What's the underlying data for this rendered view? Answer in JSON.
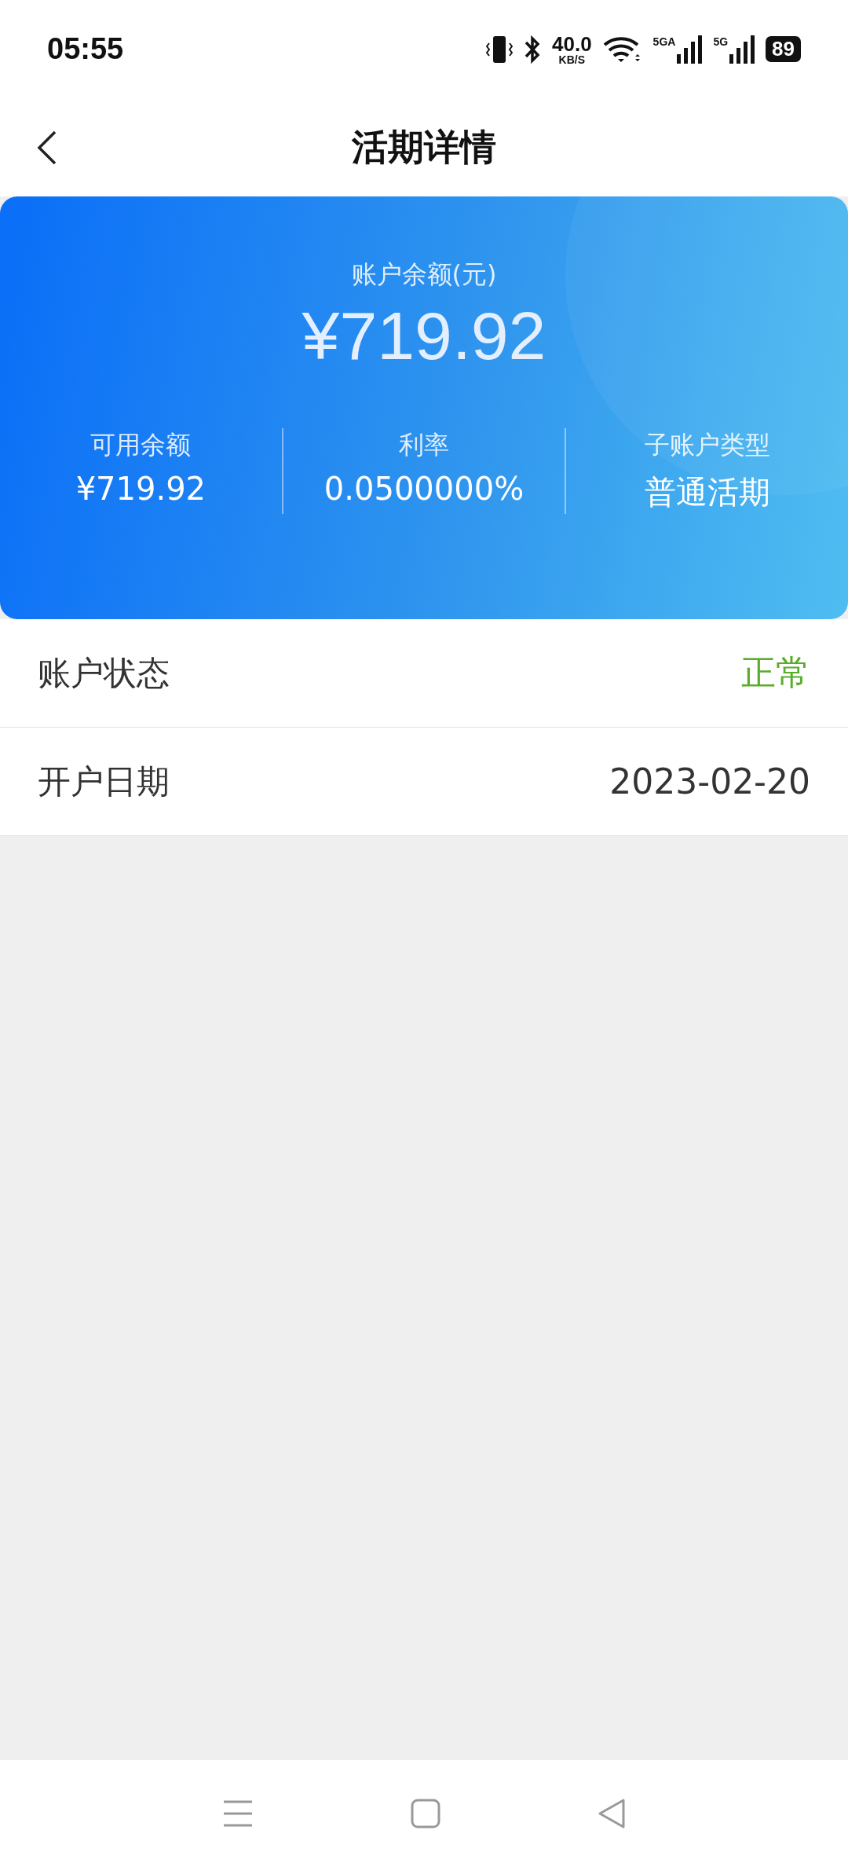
{
  "status_bar": {
    "time": "05:55",
    "speed": "40.0",
    "speed_unit": "KB/S",
    "network_1": "5GA",
    "network_2": "5G",
    "battery": "89"
  },
  "header": {
    "title": "活期详情"
  },
  "card": {
    "balance_label": "账户余额(元)",
    "balance": "¥719.92",
    "stats": [
      {
        "label": "可用余额",
        "value": "¥719.92"
      },
      {
        "label": "利率",
        "value": "0.0500000%"
      },
      {
        "label": "子账户类型",
        "value": "普通活期"
      }
    ]
  },
  "rows": [
    {
      "label": "账户状态",
      "value": "正常",
      "color": "#5aad2b"
    },
    {
      "label": "开户日期",
      "value": "2023-02-20",
      "color": "#333333"
    }
  ]
}
